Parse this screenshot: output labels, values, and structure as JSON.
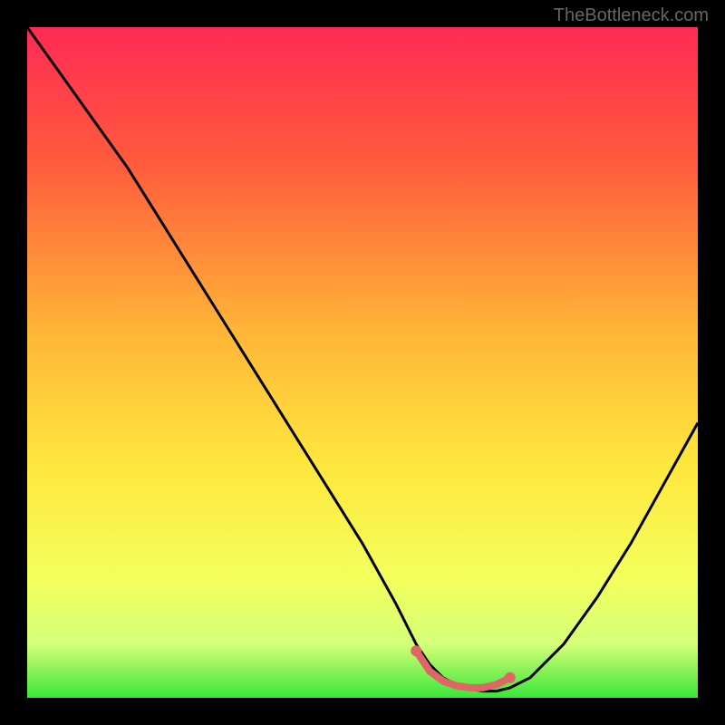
{
  "watermark": "TheBottleneck.com",
  "chart_data": {
    "type": "line",
    "title": "",
    "xlabel": "",
    "ylabel": "",
    "xlim": [
      0,
      100
    ],
    "ylim": [
      0,
      100
    ],
    "background_gradient": {
      "stops": [
        {
          "offset": 0,
          "color": "#ff2a55"
        },
        {
          "offset": 20,
          "color": "#ff5a3c"
        },
        {
          "offset": 45,
          "color": "#ffb438"
        },
        {
          "offset": 65,
          "color": "#ffe63c"
        },
        {
          "offset": 82,
          "color": "#f4ff5c"
        },
        {
          "offset": 92,
          "color": "#d4ff78"
        },
        {
          "offset": 100,
          "color": "#39e639"
        }
      ]
    },
    "series": [
      {
        "name": "bottleneck-curve",
        "x": [
          0,
          5,
          10,
          15,
          20,
          25,
          30,
          35,
          40,
          45,
          50,
          55,
          58,
          60,
          62,
          65,
          68,
          70,
          72,
          75,
          80,
          85,
          90,
          95,
          100
        ],
        "values": [
          100,
          93,
          86,
          79,
          71,
          63,
          55,
          47,
          39,
          31,
          23,
          14,
          8,
          5,
          3,
          1.5,
          1,
          1,
          1.5,
          3,
          8,
          15,
          23,
          32,
          41
        ]
      }
    ],
    "markers": {
      "name": "highlight-segment",
      "color": "#e06666",
      "x": [
        58,
        60,
        62,
        64,
        66,
        68,
        70,
        72
      ],
      "values": [
        7,
        4,
        2.5,
        1.8,
        1.5,
        1.5,
        2,
        3
      ]
    }
  }
}
